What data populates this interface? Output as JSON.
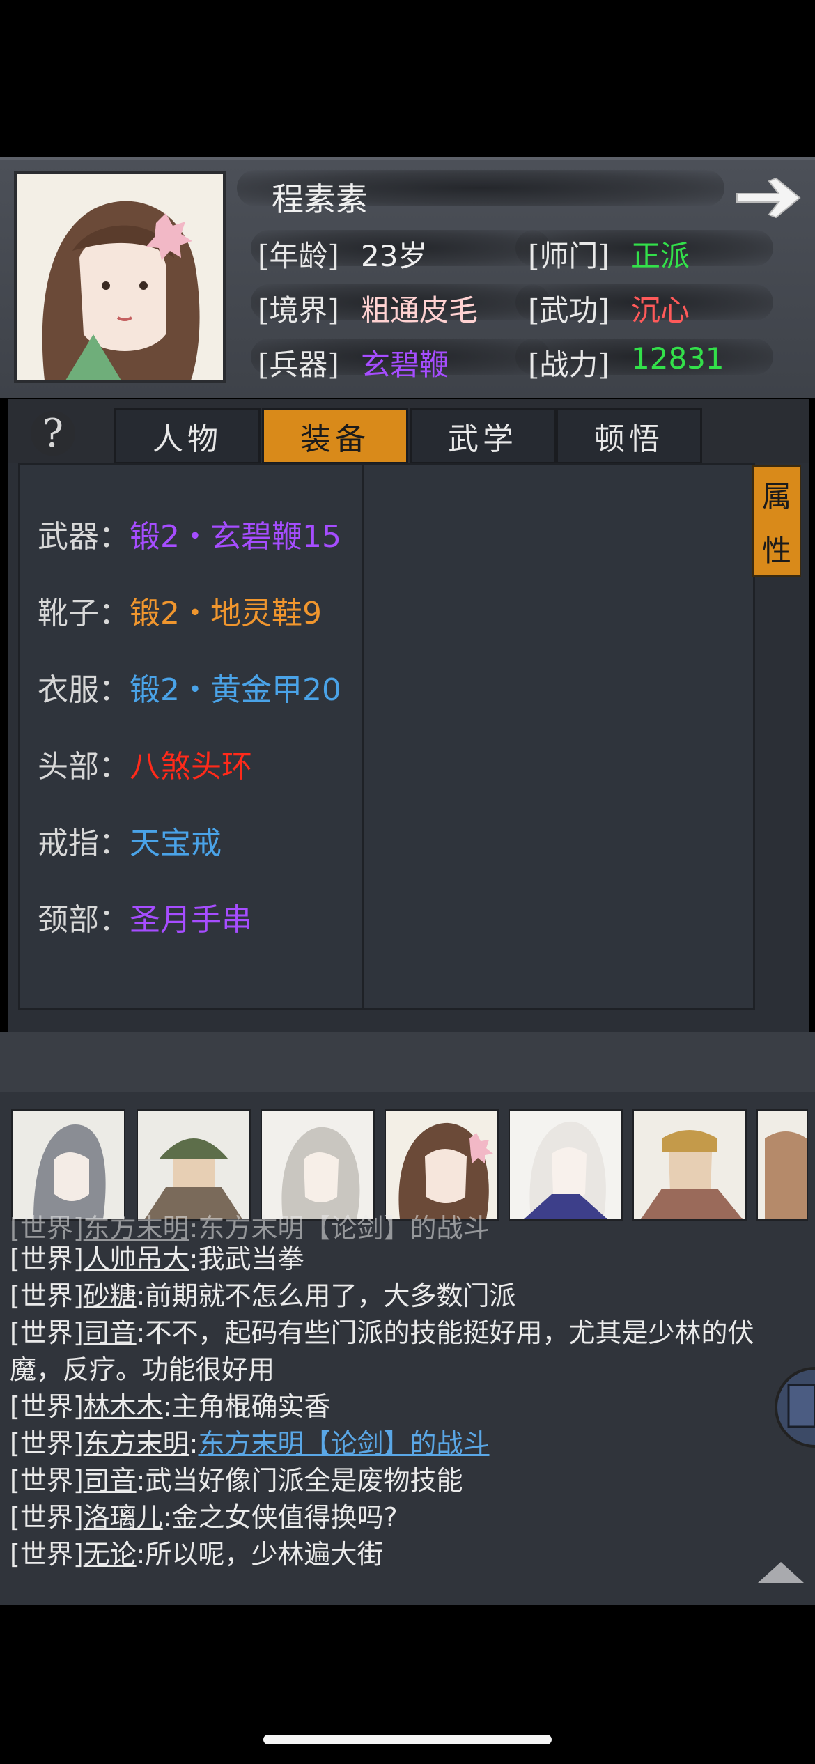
{
  "character": {
    "name": "程素素",
    "age_label": "[年龄]",
    "age": "23岁",
    "sect_label": "[师门]",
    "sect": "正派",
    "realm_label": "[境界]",
    "realm": "粗通皮毛",
    "martial_label": "[武功]",
    "martial": "沉心",
    "weapon_label": "[兵器]",
    "weapon": "玄碧鞭",
    "power_label": "[战力]",
    "power": "12831"
  },
  "tabs": [
    {
      "label": "人物",
      "active": false
    },
    {
      "label": "装备",
      "active": true
    },
    {
      "label": "武学",
      "active": false
    },
    {
      "label": "顿悟",
      "active": false
    }
  ],
  "help_icon": "question-icon",
  "attr_tab": {
    "char1": "属",
    "char2": "性"
  },
  "equipment": [
    {
      "slot": "武器：",
      "item": "锻2・玄碧鞭15",
      "color": "#a64dff"
    },
    {
      "slot": "靴子：",
      "item": "锻2・地灵鞋9",
      "color": "#f0962e"
    },
    {
      "slot": "衣服：",
      "item": "锻2・黄金甲20",
      "color": "#4aa3e8"
    },
    {
      "slot": "头部：",
      "item": "八煞头环",
      "color": "#ff2a1a"
    },
    {
      "slot": "戒指：",
      "item": "天宝戒",
      "color": "#4aa3e8"
    },
    {
      "slot": "颈部：",
      "item": "圣月手串",
      "color": "#a64dff"
    }
  ],
  "colors": {
    "sect": "#33e04a",
    "martial": "#ff5a5a",
    "weapon": "#a64dff",
    "power": "#33e04a",
    "realm": "#ffd2d2",
    "accent": "#d98a1a"
  },
  "chat": [
    {
      "channel": "[世界]",
      "name": "东方末明",
      "text": ":东方末明【论剑】的战斗",
      "partial": true
    },
    {
      "channel": "[世界]",
      "name": "人帅吊大",
      "text": ":我武当拳"
    },
    {
      "channel": "[世界]",
      "name": "砂糖",
      "text": ":前期就不怎么用了，大多数门派"
    },
    {
      "channel": "[世界]",
      "name": "司音",
      "text": ":不不，起码有些门派的技能挺好用，尤其是少林的伏"
    },
    {
      "channel": "",
      "name": "",
      "text": "魔，反疗。功能很好用"
    },
    {
      "channel": "[世界]",
      "name": "林木木",
      "text": ":主角棍确实香"
    },
    {
      "channel": "[世界]",
      "name": "东方末明",
      "text": ":",
      "link": "东方末明【论剑】的战斗"
    },
    {
      "channel": "[世界]",
      "name": "司音",
      "text": ":武当好像门派全是废物技能"
    },
    {
      "channel": "[世界]",
      "name": "洛璃儿",
      "text": ":金之女侠值得换吗?"
    },
    {
      "channel": "[世界]",
      "name": "无论",
      "text": ":所以呢，少林遍大街"
    }
  ],
  "icons": {
    "next": "arrow-right-icon",
    "scroll_up": "triangle-up-icon"
  }
}
